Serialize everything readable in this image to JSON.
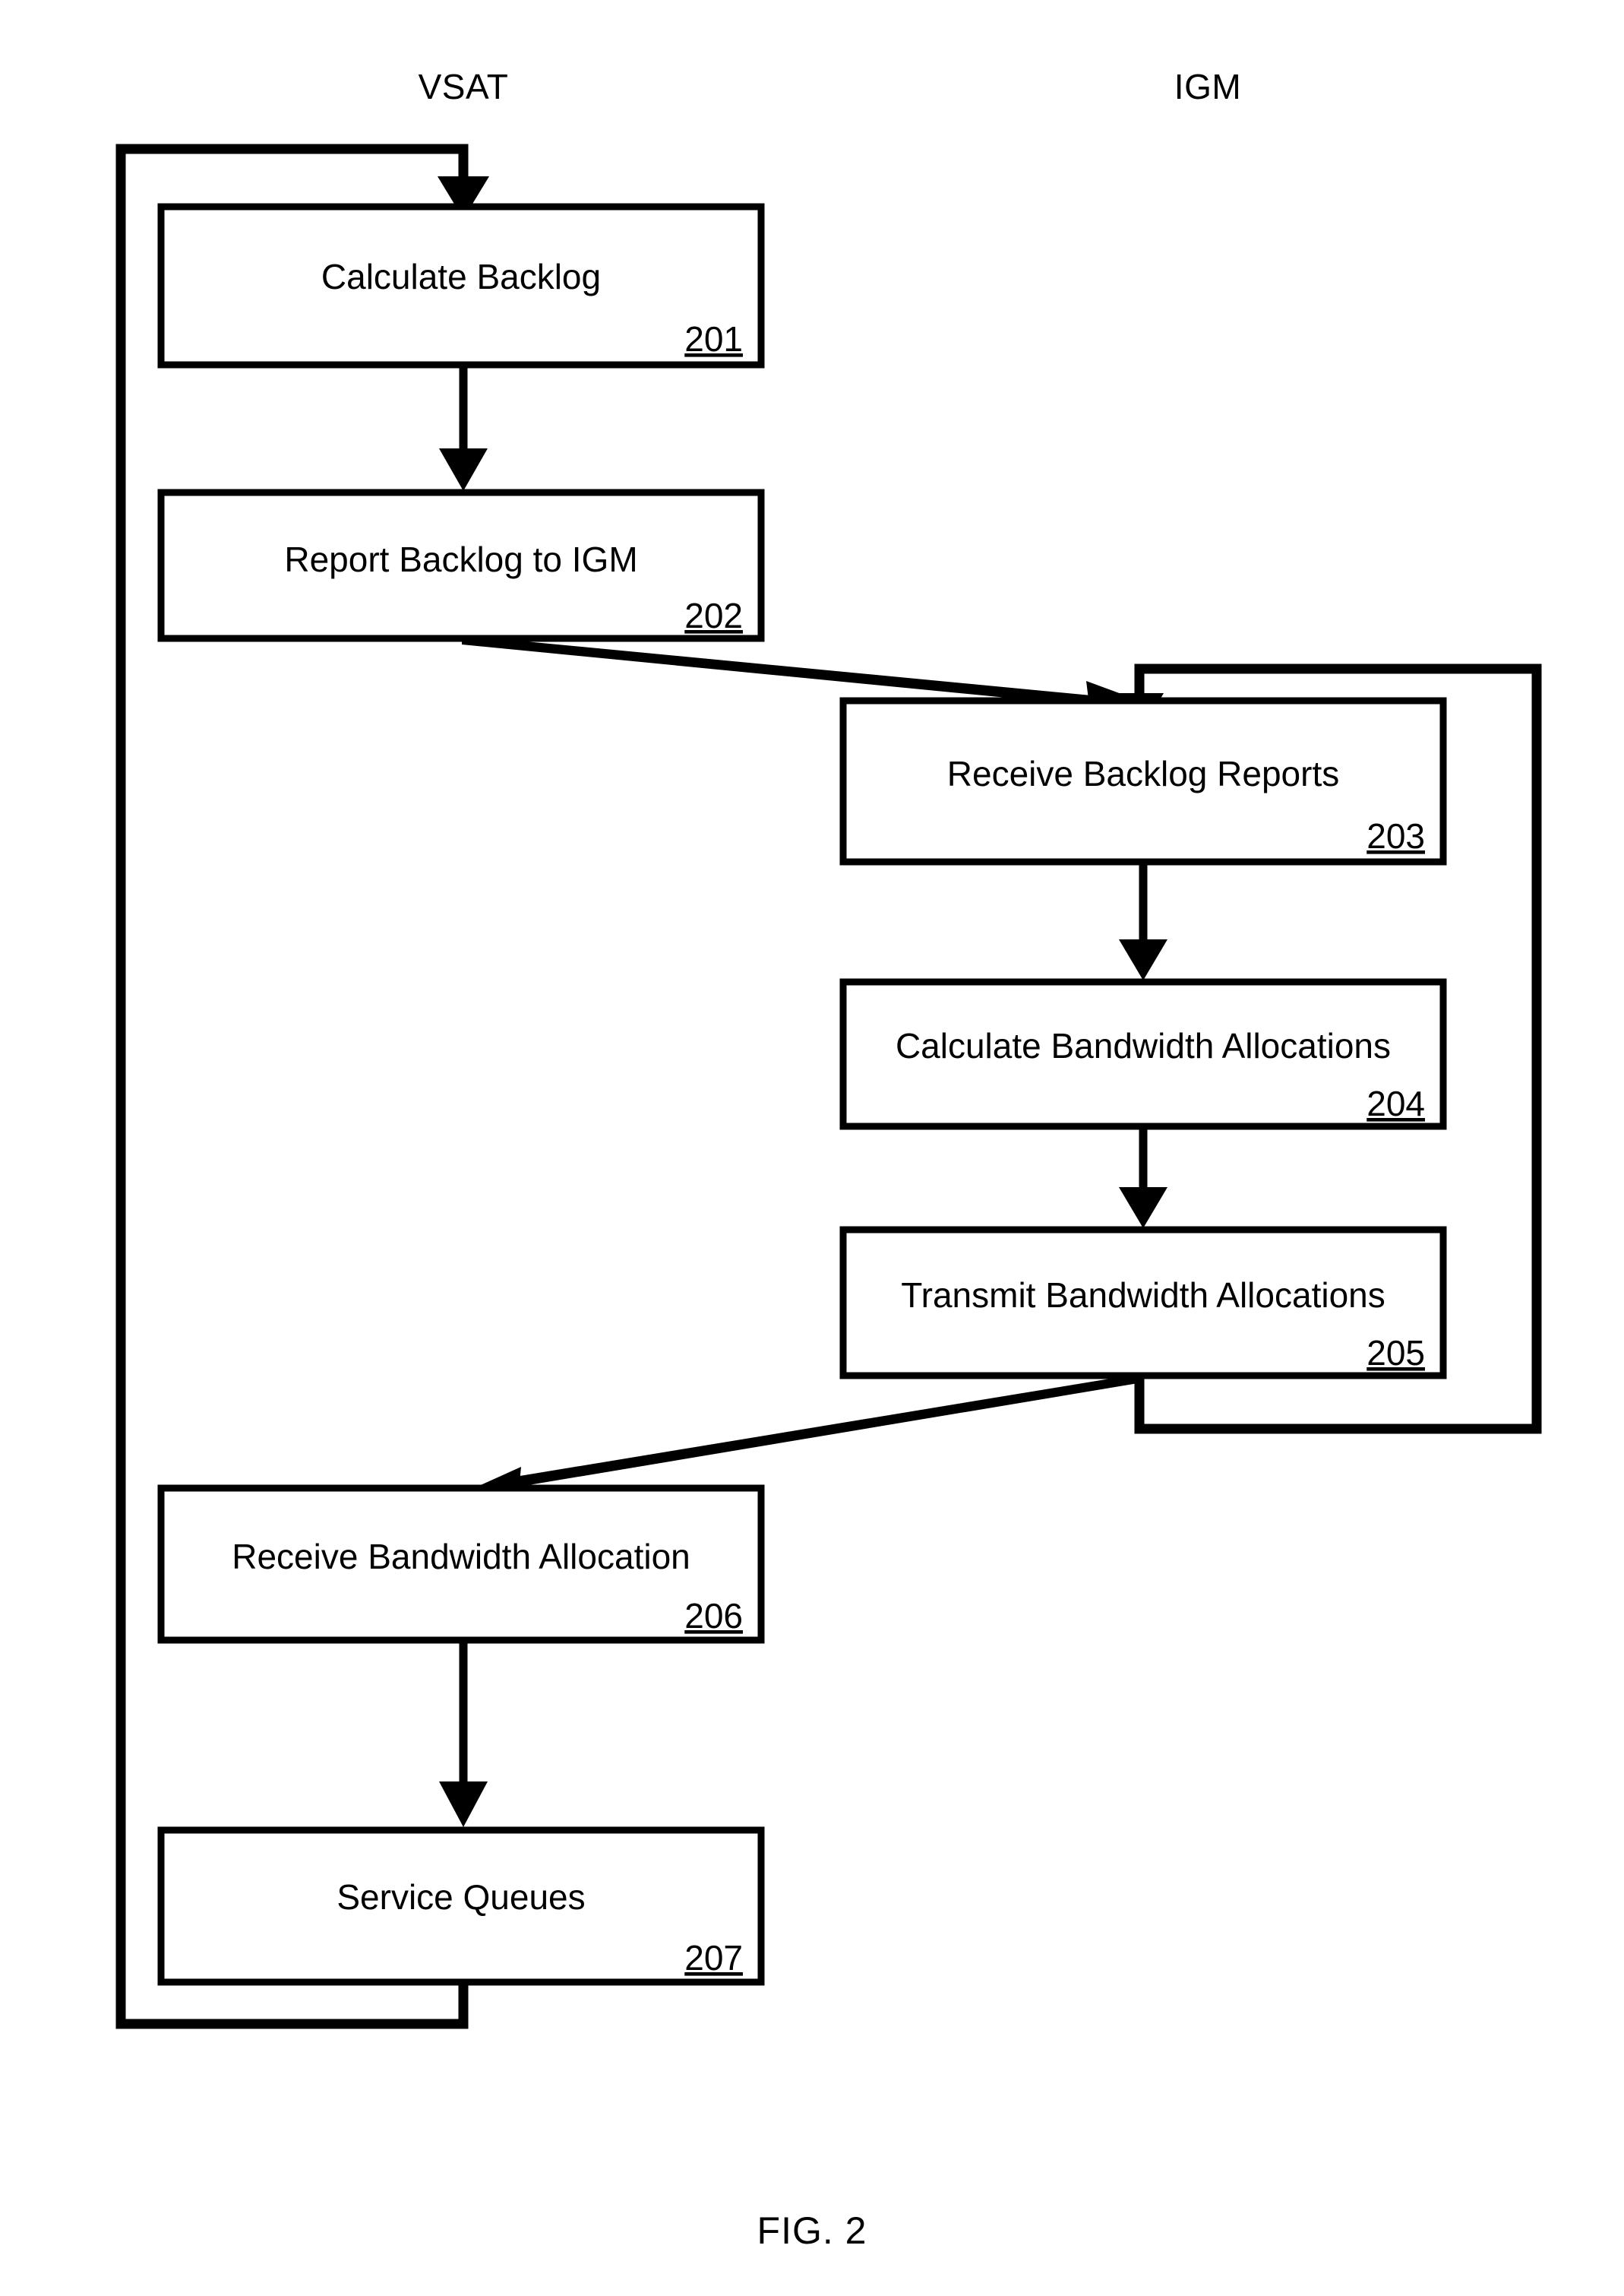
{
  "figure": {
    "caption": "FIG. 2"
  },
  "lanes": [
    {
      "id": "vsat",
      "label": "VSAT"
    },
    {
      "id": "igm",
      "label": "IGM"
    }
  ],
  "nodes": [
    {
      "id": "n201",
      "lane": "vsat",
      "label": "Calculate Backlog",
      "ref": "201"
    },
    {
      "id": "n202",
      "lane": "vsat",
      "label": "Report Backlog to IGM",
      "ref": "202"
    },
    {
      "id": "n203",
      "lane": "igm",
      "label": "Receive Backlog Reports",
      "ref": "203"
    },
    {
      "id": "n204",
      "lane": "igm",
      "label": "Calculate Bandwidth Allocations",
      "ref": "204"
    },
    {
      "id": "n205",
      "lane": "igm",
      "label": "Transmit Bandwidth Allocations",
      "ref": "205"
    },
    {
      "id": "n206",
      "lane": "vsat",
      "label": "Receive Bandwidth Allocation",
      "ref": "206"
    },
    {
      "id": "n207",
      "lane": "vsat",
      "label": "Service Queues",
      "ref": "207"
    }
  ],
  "edges": [
    {
      "id": "e201-202",
      "from": "n201",
      "to": "n202",
      "kind": "vertical"
    },
    {
      "id": "e202-203",
      "from": "n202",
      "to": "n203",
      "kind": "diagonal"
    },
    {
      "id": "e203-204",
      "from": "n203",
      "to": "n204",
      "kind": "vertical"
    },
    {
      "id": "e204-205",
      "from": "n204",
      "to": "n205",
      "kind": "vertical"
    },
    {
      "id": "e205-206",
      "from": "n205",
      "to": "n206",
      "kind": "diagonal"
    },
    {
      "id": "e206-207",
      "from": "n206",
      "to": "n207",
      "kind": "vertical"
    },
    {
      "id": "e207-201",
      "from": "n207",
      "to": "n201",
      "kind": "feedback-loop"
    },
    {
      "id": "e205-203",
      "from": "n205",
      "to": "n203",
      "kind": "feedback-loop"
    }
  ],
  "colors": {
    "stroke": "#000000",
    "fill": "#ffffff",
    "background": "#ffffff"
  }
}
